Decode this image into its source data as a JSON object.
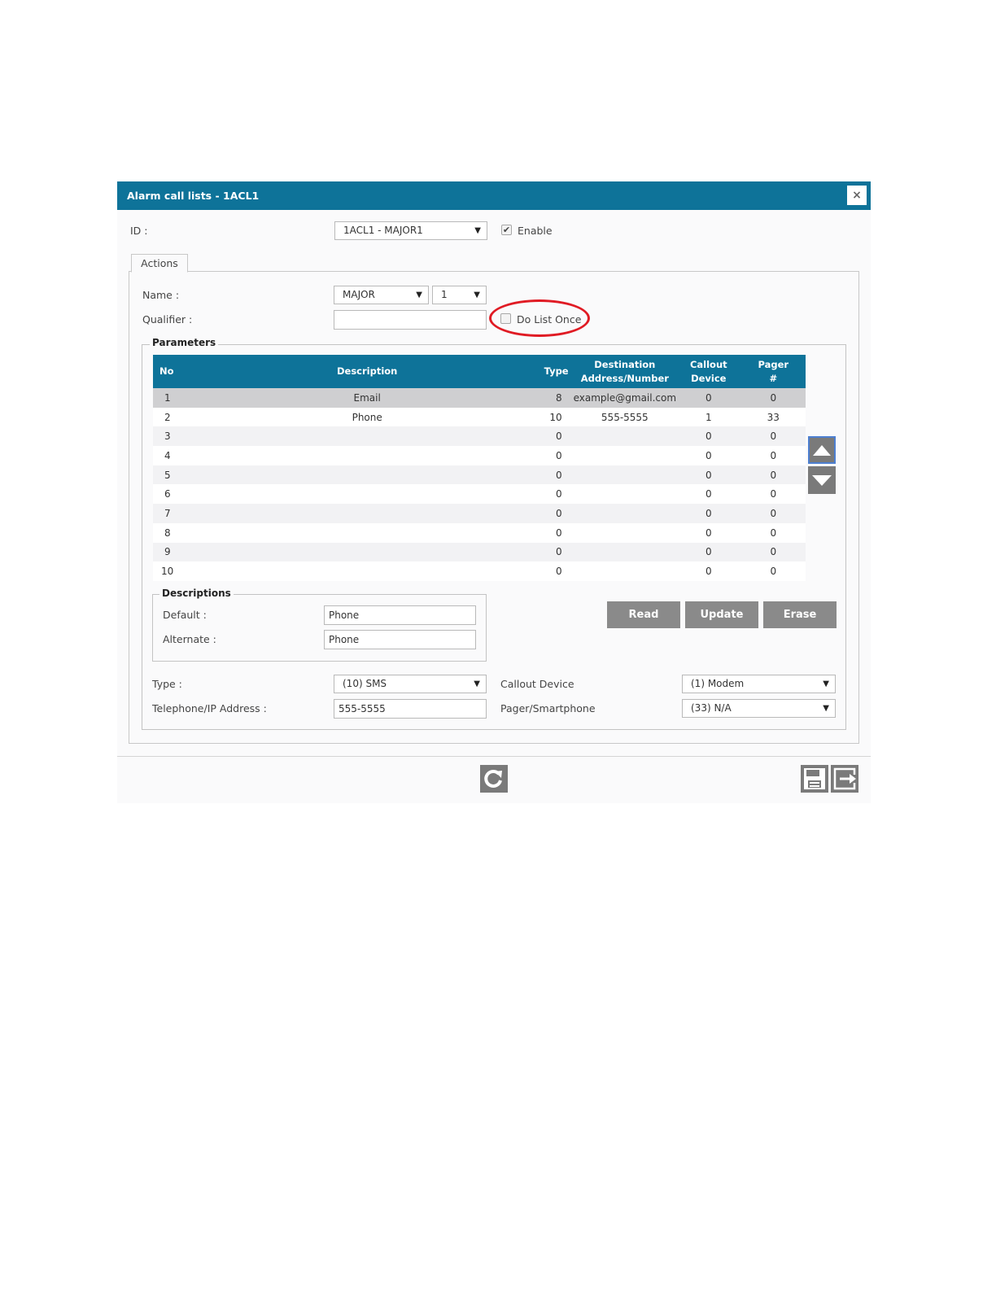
{
  "dialog": {
    "title": "Alarm call lists - 1ACL1",
    "close_label": "×"
  },
  "header": {
    "id_label": "ID :",
    "id_value": "1ACL1 - MAJOR1",
    "enable_label": "Enable",
    "enable_checked": true
  },
  "tabs": [
    {
      "label": "Actions",
      "active": true
    }
  ],
  "actions": {
    "name_label": "Name :",
    "name_value": "MAJOR",
    "name_index_value": "1",
    "qualifier_label": "Qualifier :",
    "qualifier_value": "",
    "do_list_once_label": "Do List Once",
    "do_list_once_checked": false
  },
  "parameters": {
    "legend": "Parameters",
    "columns": [
      "No",
      "Description",
      "Type",
      "Destination Address/Number",
      "Callout Device",
      "Pager #"
    ],
    "column_lines": {
      "no": "No",
      "description": "Description",
      "type": "Type",
      "destination_1": "Destination",
      "destination_2": "Address/Number",
      "callout_1": "Callout",
      "callout_2": "Device",
      "pager_1": "Pager",
      "pager_2": "#"
    },
    "rows": [
      {
        "no": "1",
        "description": "Email",
        "type": "8",
        "destination": "example@gmail.com",
        "callout": "0",
        "pager": "0",
        "selected": true
      },
      {
        "no": "2",
        "description": "Phone",
        "type": "10",
        "destination": "555-5555",
        "callout": "1",
        "pager": "33"
      },
      {
        "no": "3",
        "description": "",
        "type": "0",
        "destination": "",
        "callout": "0",
        "pager": "0"
      },
      {
        "no": "4",
        "description": "",
        "type": "0",
        "destination": "",
        "callout": "0",
        "pager": "0"
      },
      {
        "no": "5",
        "description": "",
        "type": "0",
        "destination": "",
        "callout": "0",
        "pager": "0"
      },
      {
        "no": "6",
        "description": "",
        "type": "0",
        "destination": "",
        "callout": "0",
        "pager": "0"
      },
      {
        "no": "7",
        "description": "",
        "type": "0",
        "destination": "",
        "callout": "0",
        "pager": "0"
      },
      {
        "no": "8",
        "description": "",
        "type": "0",
        "destination": "",
        "callout": "0",
        "pager": "0"
      },
      {
        "no": "9",
        "description": "",
        "type": "0",
        "destination": "",
        "callout": "0",
        "pager": "0"
      },
      {
        "no": "10",
        "description": "",
        "type": "0",
        "destination": "",
        "callout": "0",
        "pager": "0"
      }
    ]
  },
  "descriptions": {
    "legend": "Descriptions",
    "default_label": "Default :",
    "default_value": "Phone",
    "alternate_label": "Alternate :",
    "alternate_value": "Phone"
  },
  "buttons": {
    "read": "Read",
    "update": "Update",
    "erase": "Erase"
  },
  "details": {
    "type_label": "Type :",
    "type_value": "(10) SMS",
    "telephone_label": "Telephone/IP Address :",
    "telephone_value": "555-5555",
    "callout_label": "Callout Device",
    "callout_value": "(1) Modem",
    "pager_label": "Pager/Smartphone",
    "pager_value": "(33) N/A"
  },
  "icons": {
    "move_up": "arrow-up-icon",
    "move_down": "arrow-down-icon",
    "refresh": "refresh-icon",
    "save": "save-icon",
    "exit": "exit-icon"
  },
  "colors": {
    "header": "#0e7399",
    "highlight": "#e01b24",
    "button": "#8a8a8a"
  }
}
